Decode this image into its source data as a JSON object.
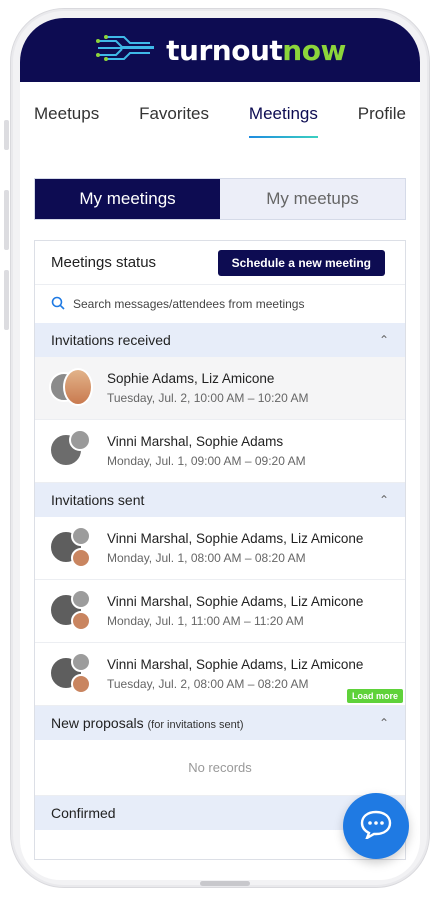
{
  "brand": {
    "name_part1": "turnout",
    "name_part2": "now",
    "accent": "#8cd53b",
    "primary": "#0d0c52"
  },
  "nav": {
    "items": [
      {
        "label": "Meetups"
      },
      {
        "label": "Favorites"
      },
      {
        "label": "Meetings"
      },
      {
        "label": "Profile"
      }
    ],
    "active": "Meetings"
  },
  "segment": {
    "my_meetings": "My meetings",
    "my_meetups": "My meetups"
  },
  "card": {
    "title": "Meetings status",
    "new_button": "Schedule a new meeting"
  },
  "search": {
    "placeholder": "Search messages/attendees from meetings"
  },
  "sections": {
    "received": {
      "label": "Invitations received",
      "rows": [
        {
          "names": "Sophie Adams, Liz Amicone",
          "time": "Tuesday, Jul. 2, 10:00 AM – 10:20 AM"
        },
        {
          "names": "Vinni Marshal, Sophie Adams",
          "time": "Monday, Jul. 1, 09:00 AM – 09:20 AM"
        }
      ]
    },
    "sent": {
      "label": "Invitations sent",
      "rows": [
        {
          "names": "Vinni Marshal, Sophie Adams, Liz Amicone",
          "time": "Monday, Jul. 1, 08:00 AM – 08:20 AM"
        },
        {
          "names": "Vinni Marshal, Sophie Adams, Liz Amicone",
          "time": "Monday, Jul. 1, 11:00 AM – 11:20 AM"
        },
        {
          "names": "Vinni Marshal, Sophie Adams, Liz Amicone",
          "time": "Tuesday, Jul. 2, 08:00 AM – 08:20 AM"
        }
      ],
      "load_more": "Load more"
    },
    "proposals": {
      "label": "New proposals",
      "sublabel": "(for invitations sent)",
      "empty": "No records"
    },
    "confirmed": {
      "label": "Confirmed"
    }
  },
  "icons": {
    "logo": "circuit-logo-icon",
    "search": "search-icon",
    "chevron": "chevron-up-icon",
    "chat": "chat-bubble-icon"
  }
}
